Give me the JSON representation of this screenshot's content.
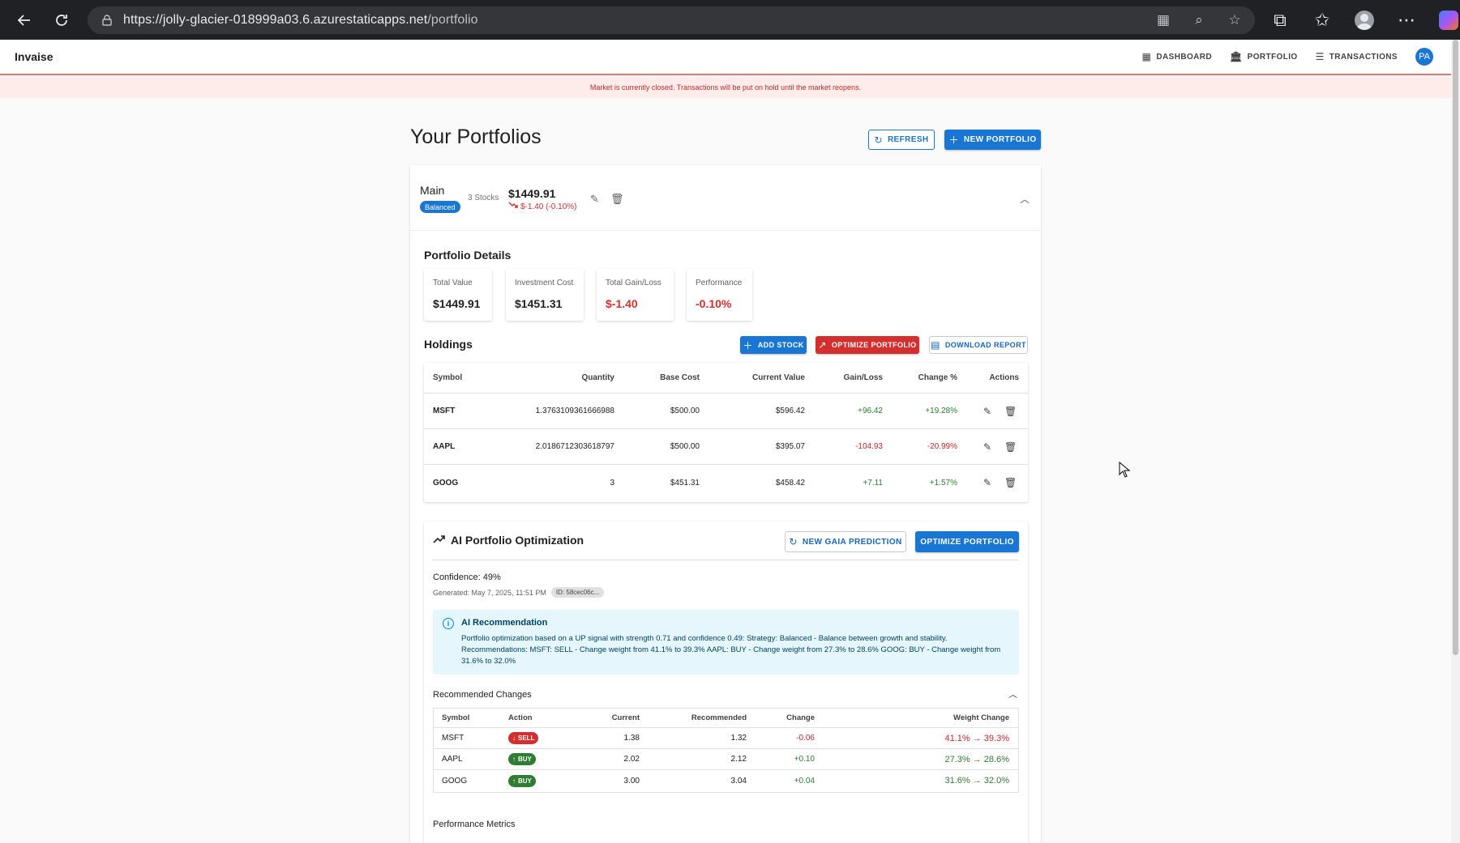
{
  "browser": {
    "url_host": "https://jolly-glacier-018999a03.6.azurestaticapps.net",
    "url_path": "/portfolio"
  },
  "app": {
    "brand": "Invaise",
    "nav": [
      {
        "label": "DASHBOARD",
        "icon": "dashboard-icon"
      },
      {
        "label": "PORTFOLIO",
        "icon": "bank-icon"
      },
      {
        "label": "TRANSACTIONS",
        "icon": "receipt-icon"
      }
    ],
    "avatar_initials": "PA",
    "market_banner": "Market is currently closed. Transactions will be put on hold until the market reopens."
  },
  "page": {
    "title": "Your Portfolios",
    "refresh_label": "REFRESH",
    "new_portfolio_label": "NEW PORTFOLIO"
  },
  "portfolio": {
    "name": "Main",
    "badge": "Balanced",
    "stocks_count": "3 Stocks",
    "value": "$1449.91",
    "change": "$-1.40 (-0.10%)",
    "details_title": "Portfolio Details",
    "metrics": [
      {
        "label": "Total Value",
        "value": "$1449.91",
        "tone": "neutral"
      },
      {
        "label": "Investment Cost",
        "value": "$1451.31",
        "tone": "neutral"
      },
      {
        "label": "Total Gain/Loss",
        "value": "$-1.40",
        "tone": "negative"
      },
      {
        "label": "Performance",
        "value": "-0.10%",
        "tone": "negative"
      }
    ],
    "holdings_title": "Holdings",
    "add_stock_label": "ADD STOCK",
    "optimize_label": "OPTIMIZE PORTFOLIO",
    "download_label": "DOWNLOAD REPORT",
    "holdings_headers": [
      "Symbol",
      "Quantity",
      "Base Cost",
      "Current Value",
      "Gain/Loss",
      "Change %",
      "Actions"
    ],
    "holdings": [
      {
        "symbol": "MSFT",
        "quantity": "1.3763109361666988",
        "base_cost": "$500.00",
        "current_value": "$596.42",
        "gain_loss": "+96.42",
        "change_pct": "+19.28%",
        "tone": "positive"
      },
      {
        "symbol": "AAPL",
        "quantity": "2.0186712303618797",
        "base_cost": "$500.00",
        "current_value": "$395.07",
        "gain_loss": "-104.93",
        "change_pct": "-20.99%",
        "tone": "negative"
      },
      {
        "symbol": "GOOG",
        "quantity": "3",
        "base_cost": "$451.31",
        "current_value": "$458.42",
        "gain_loss": "+7.11",
        "change_pct": "+1.57%",
        "tone": "positive"
      }
    ]
  },
  "ai": {
    "title": "AI Portfolio Optimization",
    "new_prediction_label": "NEW GAIA PREDICTION",
    "optimize_label": "OPTIMIZE PORTFOLIO",
    "confidence": "Confidence: 49%",
    "generated": "Generated: May 7, 2025, 11:51 PM",
    "id_chip": "ID: 58cec06c...",
    "alert_title": "AI Recommendation",
    "alert_text": "Portfolio optimization based on a UP signal with strength 0.71 and confidence 0.49: Strategy: Balanced - Balance between growth and stability. Recommendations: MSFT: SELL - Change weight from 41.1% to 39.3% AAPL: BUY - Change weight from 27.3% to 28.6% GOOG: BUY - Change weight from 31.6% to 32.0%",
    "rec_title": "Recommended Changes",
    "rec_headers": [
      "Symbol",
      "Action",
      "Current",
      "Recommended",
      "Change",
      "Weight Change"
    ],
    "recommendations": [
      {
        "symbol": "MSFT",
        "action": "SELL",
        "current": "1.38",
        "recommended": "1.32",
        "change": "-0.06",
        "weight_change": "41.1% → 39.3%",
        "tone": "negative"
      },
      {
        "symbol": "AAPL",
        "action": "BUY",
        "current": "2.02",
        "recommended": "2.12",
        "change": "+0.10",
        "weight_change": "27.3% → 28.6%",
        "tone": "positive"
      },
      {
        "symbol": "GOOG",
        "action": "BUY",
        "current": "3.00",
        "recommended": "3.04",
        "change": "+0.04",
        "weight_change": "31.6% → 32.0%",
        "tone": "positive"
      }
    ],
    "perf_title": "Performance Metrics"
  },
  "colors": {
    "primary": "#1976d2",
    "danger": "#d32f2f",
    "positive": "#2e7d32",
    "negative": "#c62828"
  }
}
